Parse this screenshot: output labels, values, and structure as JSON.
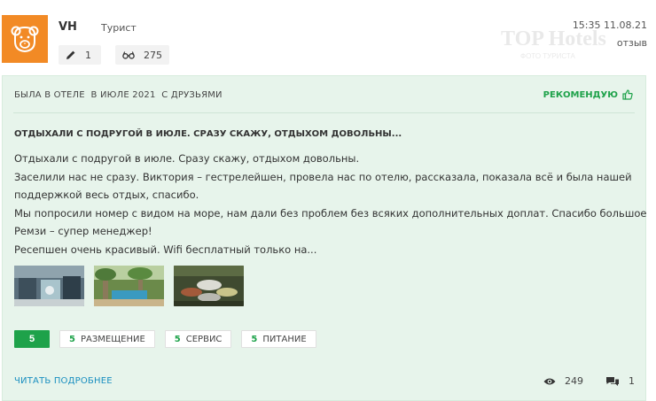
{
  "user": {
    "name": "VH",
    "role": "Турист",
    "posts_count": "1",
    "views_count": "275",
    "avatar_icon": "bear-face-icon",
    "avatar_color": "#f28a25"
  },
  "post": {
    "datetime": "15:35 11.08.21",
    "type_label": "отзыв"
  },
  "watermark": {
    "logo_text": "TOP Hotels",
    "tagline": "ФОТО ТУРИСТА"
  },
  "review": {
    "meta": "БЫЛА В ОТЕЛЕ  В ИЮЛЕ 2021  С ДРУЗЬЯМИ",
    "recommend_label": "РЕКОМЕНДУЮ",
    "title": "ОТДЫХАЛИ С ПОДРУГОЙ В ИЮЛЕ. СРАЗУ СКАЖУ, ОТДЫХОМ ДОВОЛЬНЫ...",
    "lines": [
      "Отдыхали с подругой в июле. Сразу скажу, отдыхом довольны.",
      "Заселили нас не сразу. Виктория – гестрелейшен, провела нас по отелю, рассказала, показала всё и была нашей",
      "поддержкой весь отдых, спасибо.",
      "Мы попросили номер с видом на море, нам дали без проблем без всяких дополнительных доплат. Спасибо большое",
      "Ремзи – супер менеджер!",
      "Ресепшен очень красивый. Wifi бесплатный только на..."
    ],
    "read_more": "ЧИТАТЬ ПОДРОБНЕЕ"
  },
  "ratings": {
    "overall": "5",
    "items": [
      {
        "score": "5",
        "label": "РАЗМЕЩЕНИЕ"
      },
      {
        "score": "5",
        "label": "СЕРВИС"
      },
      {
        "score": "5",
        "label": "ПИТАНИЕ"
      }
    ]
  },
  "counters": {
    "views": "249",
    "comments": "1"
  },
  "colors": {
    "accent_green": "#1ea24a",
    "card_bg": "#e7f4eb",
    "link_blue": "#1a8fc0"
  }
}
